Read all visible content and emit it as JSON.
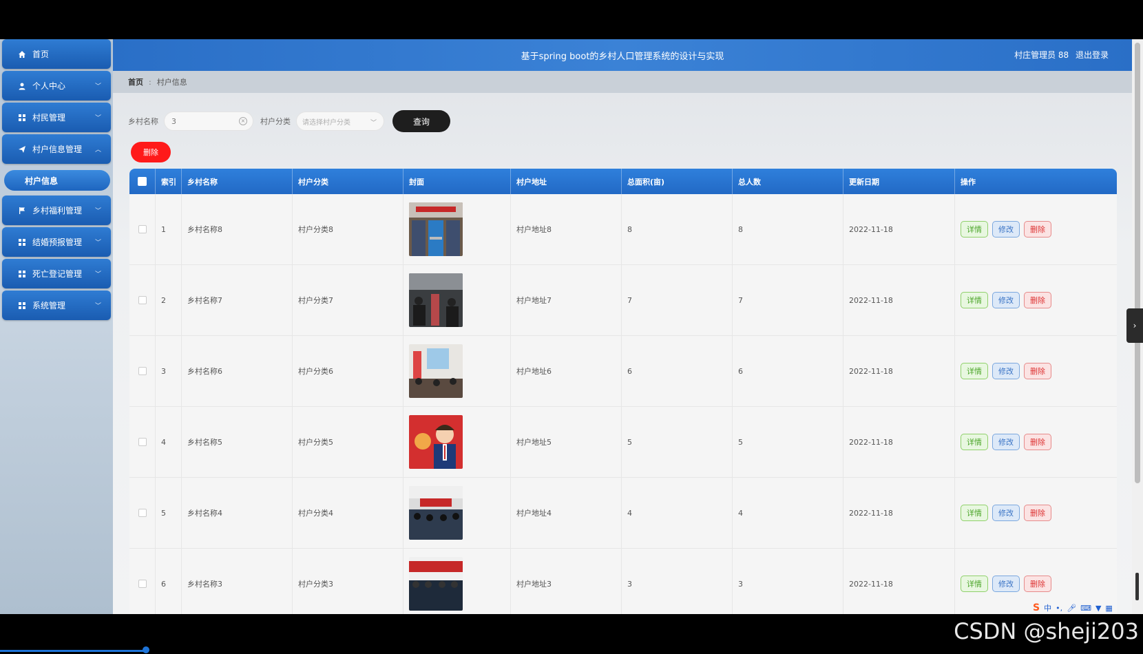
{
  "app": {
    "title": "基于spring boot的乡村人口管理系统的设计与实现",
    "user_role": "村庄管理员 88",
    "logout": "退出登录"
  },
  "sidebar": {
    "items": [
      {
        "label": "首页",
        "icon": "home-icon",
        "expanded": false
      },
      {
        "label": "个人中心",
        "icon": "user-icon",
        "expanded": false
      },
      {
        "label": "村民管理",
        "icon": "grid-icon",
        "expanded": false
      },
      {
        "label": "村户信息管理",
        "icon": "send-icon",
        "expanded": true
      },
      {
        "label": "乡村福利管理",
        "icon": "flag-icon",
        "expanded": false
      },
      {
        "label": "结婚预报管理",
        "icon": "grid-icon",
        "expanded": false
      },
      {
        "label": "死亡登记管理",
        "icon": "grid-icon",
        "expanded": false
      },
      {
        "label": "系统管理",
        "icon": "grid-icon",
        "expanded": false
      }
    ],
    "sub_item": "村户信息"
  },
  "breadcrumb": {
    "home": "首页",
    "current": "村户信息"
  },
  "search": {
    "name_label": "乡村名称",
    "name_value": "3",
    "category_label": "村户分类",
    "category_placeholder": "请选择村户分类",
    "query_button": "查询"
  },
  "toolbar": {
    "delete_label": "删除"
  },
  "table": {
    "headers": [
      "索引",
      "乡村名称",
      "村户分类",
      "封面",
      "村户地址",
      "总面积(亩)",
      "总人数",
      "更新日期",
      "操作"
    ],
    "actions": {
      "detail": "详情",
      "edit": "修改",
      "delete": "删除"
    },
    "rows": [
      {
        "index": "1",
        "name": "乡村名称8",
        "category": "村户分类8",
        "address": "村户地址8",
        "area": "8",
        "people": "8",
        "date": "2022-11-18",
        "cover": "meeting-hall"
      },
      {
        "index": "2",
        "name": "乡村名称7",
        "category": "村户分类7",
        "address": "村户地址7",
        "area": "7",
        "people": "7",
        "date": "2022-11-18",
        "cover": "crowd-meeting"
      },
      {
        "index": "3",
        "name": "乡村名称6",
        "category": "村户分类6",
        "address": "村户地址6",
        "area": "6",
        "people": "6",
        "date": "2022-11-18",
        "cover": "projector-meeting"
      },
      {
        "index": "4",
        "name": "乡村名称5",
        "category": "村户分类5",
        "address": "村户地址5",
        "area": "5",
        "people": "5",
        "date": "2022-11-18",
        "cover": "cartoon-official"
      },
      {
        "index": "5",
        "name": "乡村名称4",
        "category": "村户分类4",
        "address": "村户地址4",
        "area": "4",
        "people": "4",
        "date": "2022-11-18",
        "cover": "conference-room"
      },
      {
        "index": "6",
        "name": "乡村名称3",
        "category": "村户分类3",
        "address": "村户地址3",
        "area": "3",
        "people": "3",
        "date": "2022-11-18",
        "cover": "stage-meeting"
      }
    ]
  },
  "ime": {
    "logo": "S",
    "lang": "中",
    "punct": "•,"
  },
  "watermark": "CSDN @sheji203"
}
